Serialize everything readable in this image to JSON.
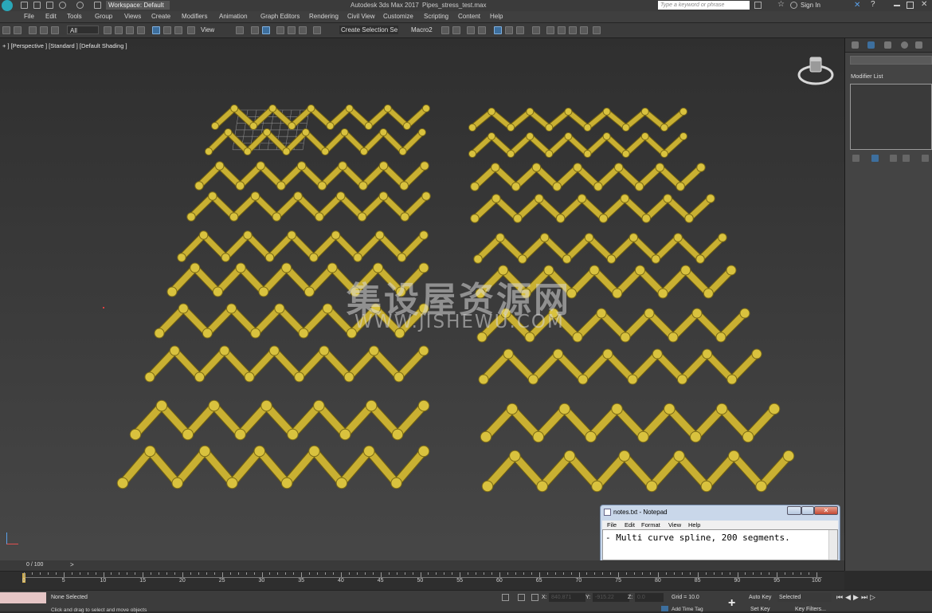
{
  "window": {
    "workspace_label": "Workspace: Default",
    "app_title": "Autodesk 3ds Max 2017",
    "file_title": "Pipes_stress_test.max",
    "search_placeholder": "Type a keyword or phrase",
    "sign_in": "Sign In"
  },
  "menu": [
    "File",
    "Edit",
    "Tools",
    "Group",
    "Views",
    "Create",
    "Modifiers",
    "Animation",
    "Graph Editors",
    "Rendering",
    "Civil View",
    "Customize",
    "Scripting",
    "Content",
    "Help"
  ],
  "toolbar": {
    "filter": "All",
    "view": "View",
    "selection_set": "Create Selection Se",
    "macro": "Macro2"
  },
  "viewport": {
    "label": "+ ] [Perspective ] [Standard ] [Default Shading ]",
    "pipe_color": "#c9b032",
    "watermark_cn": "集设屋资源网",
    "watermark_url": "WWW.JISHEWU.COM"
  },
  "command_panel": {
    "modifier_list": "Modifier List"
  },
  "notepad": {
    "title": "notes.txt - Notepad",
    "menu": [
      "File",
      "Edit",
      "Format",
      "View",
      "Help"
    ],
    "content": "- Multi curve spline, 200 segments."
  },
  "timeline": {
    "frame_readout": "0 / 100",
    "next": ">",
    "tick_labels": [
      "0",
      "5",
      "10",
      "15",
      "20",
      "25",
      "30",
      "35",
      "40",
      "45",
      "50",
      "55",
      "60",
      "65",
      "70",
      "75",
      "80",
      "85",
      "90",
      "95",
      "100"
    ]
  },
  "status": {
    "selection": "None Selected",
    "prompt": "Click and drag to select and move objects",
    "x_label": "X:",
    "x_value": "840.871",
    "y_label": "Y:",
    "y_value": "-915.22",
    "z_label": "Z:",
    "z_value": "0.0",
    "grid": "Grid = 10.0",
    "auto_key": "Auto Key",
    "selected": "Selected",
    "set_key": "Set Key",
    "key_filters": "Key Filters...",
    "add_time_tag": "Add Time Tag"
  }
}
